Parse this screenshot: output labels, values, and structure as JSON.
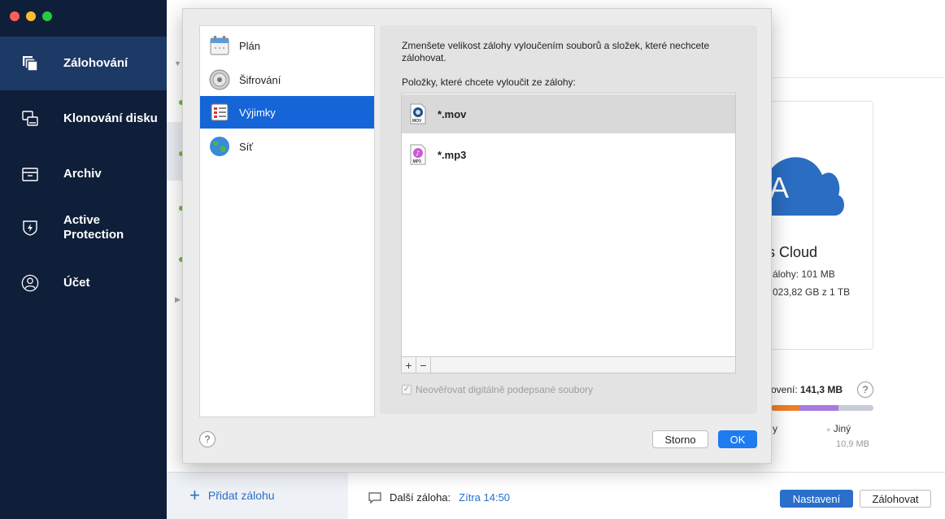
{
  "sidebar": {
    "items": [
      {
        "label": "Zálohování",
        "icon": "backup-stack-icon",
        "active": true
      },
      {
        "label": "Klonování disku",
        "icon": "disk-clone-icon"
      },
      {
        "label": "Archiv",
        "icon": "archive-box-icon"
      },
      {
        "label": "Active",
        "label2": "Protection",
        "icon": "shield-bolt-icon"
      },
      {
        "label": "Účet",
        "icon": "user-circle-icon"
      }
    ]
  },
  "main": {
    "cloud_title": "is Cloud",
    "cloud_line1": "álohy: 101 MB",
    "cloud_line2": "023,82 GB z 1 TB",
    "usage_label": "ovení: ",
    "usage_value": "141,3 MB",
    "legend_left": "y",
    "legend_other": "Jiný",
    "legend_other_size": "10,9 MB",
    "colors": {
      "orange": "#f07d2a",
      "purple": "#a77be0",
      "gray": "#c7ccd6"
    }
  },
  "bottom": {
    "add_backup": "Přidat zálohu",
    "next_backup_label": "Další záloha:",
    "next_backup_time": "Zítra 14:50",
    "settings_button": "Nastavení",
    "backup_button": "Zálohovat"
  },
  "dialog": {
    "categories": [
      {
        "label": "Plán",
        "icon": "calendar-icon"
      },
      {
        "label": "Šifrování",
        "icon": "encryption-lock-icon"
      },
      {
        "label": "Výjimky",
        "icon": "exclusions-list-icon",
        "active": true
      },
      {
        "label": "Síť",
        "icon": "globe-icon"
      }
    ],
    "description": "Zmenšete velikost zálohy vyloučením souborů a složek, které nechcete zálohovat.",
    "list_heading": "Položky, které chcete vyloučit ze zálohy:",
    "exclusions": [
      {
        "label": "*.mov",
        "icon": "mov-file-icon",
        "selected": true
      },
      {
        "label": "*.mp3",
        "icon": "mp3-file-icon"
      }
    ],
    "add_symbol": "+",
    "remove_symbol": "−",
    "checkbox_label": "Neověřovat digitálně podepsané soubory",
    "checkbox_checked": true,
    "help_symbol": "?",
    "cancel_button": "Storno",
    "ok_button": "OK"
  }
}
